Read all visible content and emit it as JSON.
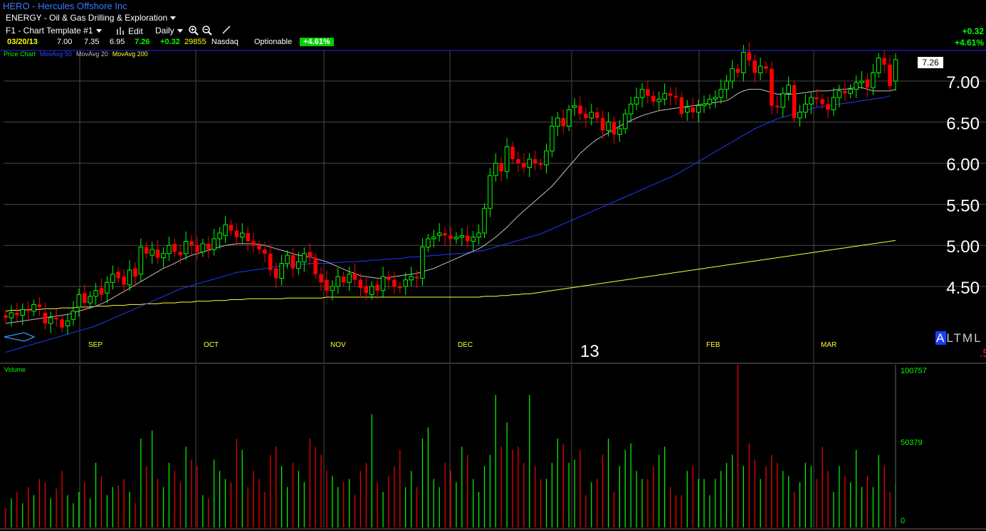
{
  "header": {
    "title": "HERO - Hercules Offshore Inc",
    "sector": "ENERGY - Oil & Gas Drilling & Exploration",
    "template": "F1 - Chart Template #1",
    "edit_label": "Edit",
    "period": "Daily",
    "quote": {
      "date": "03/20/13",
      "open": "7.00",
      "high": "7.35",
      "low": "6.95",
      "last": "7.26",
      "change": "+0.32",
      "volume": "29855",
      "exchange": "Nasdaq",
      "optionable": "Optionable",
      "pct_change": "+4.61%"
    },
    "right_change": "+0.32",
    "right_pct": "+4.61%"
  },
  "legend": {
    "price_chart": "Price Chart",
    "ma50": "MovAvg 50",
    "ma20": "MovAvg 20",
    "ma200": "MovAvg 200"
  },
  "last_price_badge": "7.26",
  "year_label": "13",
  "altml": {
    "a": "A",
    "rest": "LTML"
  },
  "red_mark": ".5",
  "colors": {
    "up": "#00ff00",
    "down": "#ff0000",
    "ma50": "#1f3cff",
    "ma20": "#c0c0c0",
    "ma200": "#ffff33",
    "grid": "#4a4a4a",
    "frame": "#2a2aff"
  },
  "chart_data": [
    {
      "type": "candlestick",
      "ylim": [
        4.0,
        7.5
      ],
      "y_ticks": [
        "7.00",
        "6.50",
        "6.00",
        "5.50",
        "5.00",
        "4.50"
      ],
      "x_tick_labels": [
        "SEP",
        "OCT",
        "NOV",
        "DEC",
        "FEB",
        "MAR"
      ],
      "grid": true,
      "close": [
        4.12,
        4.18,
        4.15,
        4.22,
        4.2,
        4.28,
        4.25,
        4.05,
        4.12,
        4.1,
        4.0,
        4.08,
        4.2,
        4.4,
        4.3,
        4.38,
        4.45,
        4.4,
        4.55,
        4.65,
        4.6,
        4.52,
        4.7,
        4.62,
        4.98,
        4.9,
        4.95,
        4.85,
        4.9,
        5.0,
        4.92,
        4.88,
        5.05,
        5.0,
        4.92,
        5.02,
        4.95,
        5.08,
        5.15,
        5.25,
        5.18,
        5.1,
        5.15,
        5.05,
        5.0,
        4.95,
        4.9,
        4.7,
        4.6,
        4.78,
        4.88,
        4.72,
        4.8,
        4.9,
        4.85,
        4.65,
        4.55,
        4.45,
        4.5,
        4.62,
        4.55,
        4.65,
        4.58,
        4.48,
        4.42,
        4.5,
        4.45,
        4.62,
        4.58,
        4.5,
        4.48,
        4.58,
        4.62,
        4.6,
        4.98,
        5.08,
        5.1,
        5.15,
        5.12,
        5.08,
        5.1,
        5.12,
        5.05,
        5.1,
        5.15,
        5.45,
        5.85,
        6.0,
        5.9,
        6.2,
        6.05,
        6.0,
        5.95,
        6.05,
        6.0,
        5.98,
        6.15,
        6.45,
        6.55,
        6.45,
        6.65,
        6.7,
        6.6,
        6.55,
        6.62,
        6.55,
        6.4,
        6.5,
        6.35,
        6.42,
        6.6,
        6.72,
        6.8,
        6.9,
        6.82,
        6.75,
        6.78,
        6.85,
        6.82,
        6.8,
        6.6,
        6.68,
        6.62,
        6.7,
        6.72,
        6.78,
        6.8,
        6.9,
        7.0,
        7.15,
        7.1,
        7.35,
        7.25,
        7.1,
        7.18,
        7.15,
        6.7,
        6.68,
        6.85,
        6.95,
        6.55,
        6.62,
        6.72,
        6.8,
        6.78,
        6.72,
        6.65,
        6.8,
        6.88,
        6.85,
        6.9,
        6.98,
        7.0,
        6.92,
        7.1,
        7.28,
        7.2,
        6.94,
        7.26
      ],
      "open": [
        4.15,
        4.12,
        4.18,
        4.15,
        4.22,
        4.2,
        4.28,
        4.18,
        4.05,
        4.12,
        4.1,
        4.02,
        4.1,
        4.25,
        4.42,
        4.3,
        4.38,
        4.48,
        4.42,
        4.55,
        4.68,
        4.62,
        4.52,
        4.72,
        4.65,
        4.98,
        4.88,
        4.95,
        4.85,
        4.9,
        5.02,
        4.92,
        4.9,
        5.05,
        5.0,
        4.92,
        5.02,
        4.95,
        5.08,
        5.12,
        5.25,
        5.18,
        5.1,
        5.15,
        5.05,
        5.0,
        4.95,
        4.9,
        4.72,
        4.6,
        4.78,
        4.88,
        4.72,
        4.8,
        4.92,
        4.85,
        4.65,
        4.58,
        4.45,
        4.5,
        4.62,
        4.55,
        4.66,
        4.58,
        4.5,
        4.4,
        4.52,
        4.45,
        4.62,
        4.58,
        4.5,
        4.5,
        4.58,
        4.62,
        4.6,
        4.98,
        5.08,
        5.12,
        5.15,
        5.12,
        5.08,
        5.1,
        5.12,
        5.05,
        5.1,
        5.15,
        5.45,
        5.85,
        6.0,
        5.9,
        6.2,
        6.05,
        6.0,
        5.95,
        6.05,
        6.0,
        5.98,
        6.15,
        6.45,
        6.55,
        6.45,
        6.68,
        6.7,
        6.6,
        6.55,
        6.62,
        6.55,
        6.4,
        6.5,
        6.35,
        6.42,
        6.6,
        6.72,
        6.8,
        6.9,
        6.82,
        6.75,
        6.78,
        6.85,
        6.82,
        6.8,
        6.62,
        6.68,
        6.62,
        6.7,
        6.72,
        6.78,
        6.8,
        6.9,
        7.0,
        7.15,
        7.1,
        7.35,
        7.25,
        7.1,
        7.18,
        7.15,
        6.7,
        6.68,
        6.85,
        6.95,
        6.55,
        6.62,
        6.72,
        6.8,
        6.78,
        6.72,
        6.65,
        6.8,
        6.88,
        6.85,
        6.9,
        6.98,
        7.02,
        6.92,
        7.1,
        7.28,
        7.2,
        7.0
      ],
      "ma20": [
        4.05,
        4.06,
        4.07,
        4.08,
        4.09,
        4.1,
        4.11,
        4.12,
        4.13,
        4.14,
        4.15,
        4.16,
        4.18,
        4.2,
        4.22,
        4.24,
        4.26,
        4.29,
        4.32,
        4.36,
        4.4,
        4.44,
        4.48,
        4.52,
        4.56,
        4.6,
        4.64,
        4.68,
        4.72,
        4.75,
        4.78,
        4.82,
        4.85,
        4.88,
        4.9,
        4.92,
        4.94,
        4.96,
        4.98,
        5.0,
        5.01,
        5.02,
        5.02,
        5.02,
        5.02,
        5.01,
        5.0,
        4.98,
        4.96,
        4.94,
        4.92,
        4.9,
        4.88,
        4.87,
        4.86,
        4.84,
        4.82,
        4.8,
        4.77,
        4.74,
        4.71,
        4.68,
        4.66,
        4.63,
        4.62,
        4.61,
        4.6,
        4.6,
        4.61,
        4.62,
        4.63,
        4.64,
        4.65,
        4.66,
        4.68,
        4.7,
        4.72,
        4.75,
        4.78,
        4.81,
        4.84,
        4.87,
        4.9,
        4.93,
        4.96,
        5.0,
        5.05,
        5.1,
        5.16,
        5.22,
        5.29,
        5.36,
        5.42,
        5.48,
        5.54,
        5.6,
        5.66,
        5.72,
        5.8,
        5.88,
        5.96,
        6.04,
        6.12,
        6.18,
        6.24,
        6.29,
        6.33,
        6.37,
        6.41,
        6.45,
        6.49,
        6.52,
        6.55,
        6.58,
        6.6,
        6.62,
        6.64,
        6.65,
        6.66,
        6.67,
        6.68,
        6.69,
        6.7,
        6.71,
        6.72,
        6.73,
        6.74,
        6.75,
        6.76,
        6.8,
        6.85,
        6.88,
        6.9,
        6.9,
        6.9,
        6.88,
        6.86,
        6.84,
        6.84,
        6.84,
        6.84,
        6.85,
        6.86,
        6.87,
        6.88,
        6.88,
        6.88,
        6.89,
        6.9,
        6.9,
        6.91,
        6.92,
        6.92,
        6.9,
        6.88,
        6.88,
        6.88,
        6.88,
        6.9
      ],
      "ma50": [
        3.7,
        3.72,
        3.74,
        3.76,
        3.78,
        3.8,
        3.82,
        3.84,
        3.86,
        3.88,
        3.9,
        3.92,
        3.94,
        3.96,
        3.98,
        4.0,
        4.02,
        4.05,
        4.08,
        4.11,
        4.14,
        4.17,
        4.2,
        4.23,
        4.26,
        4.29,
        4.32,
        4.35,
        4.38,
        4.41,
        4.44,
        4.47,
        4.49,
        4.51,
        4.53,
        4.55,
        4.57,
        4.59,
        4.61,
        4.63,
        4.65,
        4.67,
        4.68,
        4.69,
        4.7,
        4.71,
        4.72,
        4.73,
        4.74,
        4.75,
        4.76,
        4.76,
        4.77,
        4.77,
        4.78,
        4.78,
        4.78,
        4.78,
        4.79,
        4.79,
        4.8,
        4.8,
        4.8,
        4.81,
        4.81,
        4.82,
        4.82,
        4.83,
        4.83,
        4.84,
        4.84,
        4.85,
        4.86,
        4.86,
        4.87,
        4.87,
        4.88,
        4.88,
        4.89,
        4.89,
        4.9,
        4.9,
        4.91,
        4.92,
        4.93,
        4.94,
        4.96,
        4.98,
        5.0,
        5.02,
        5.04,
        5.06,
        5.08,
        5.1,
        5.12,
        5.14,
        5.17,
        5.2,
        5.23,
        5.26,
        5.29,
        5.32,
        5.35,
        5.38,
        5.41,
        5.44,
        5.47,
        5.5,
        5.53,
        5.56,
        5.59,
        5.62,
        5.65,
        5.68,
        5.71,
        5.74,
        5.77,
        5.8,
        5.83,
        5.86,
        5.9,
        5.94,
        5.98,
        6.02,
        6.06,
        6.1,
        6.14,
        6.18,
        6.22,
        6.26,
        6.3,
        6.34,
        6.38,
        6.42,
        6.45,
        6.48,
        6.51,
        6.54,
        6.56,
        6.58,
        6.6,
        6.62,
        6.64,
        6.66,
        6.68,
        6.69,
        6.7,
        6.71,
        6.72,
        6.73,
        6.74,
        6.75,
        6.76,
        6.77,
        6.78,
        6.79,
        6.8,
        6.82
      ],
      "ma200": [
        4.2,
        4.21,
        4.21,
        4.21,
        4.22,
        4.22,
        4.22,
        4.23,
        4.23,
        4.23,
        4.24,
        4.24,
        4.24,
        4.25,
        4.25,
        4.25,
        4.26,
        4.26,
        4.26,
        4.27,
        4.27,
        4.27,
        4.28,
        4.28,
        4.28,
        4.29,
        4.29,
        4.29,
        4.3,
        4.3,
        4.3,
        4.31,
        4.31,
        4.31,
        4.32,
        4.32,
        4.32,
        4.33,
        4.33,
        4.33,
        4.34,
        4.34,
        4.34,
        4.35,
        4.35,
        4.35,
        4.35,
        4.35,
        4.35,
        4.35,
        4.36,
        4.36,
        4.36,
        4.36,
        4.36,
        4.36,
        4.36,
        4.37,
        4.37,
        4.37,
        4.37,
        4.37,
        4.37,
        4.37,
        4.37,
        4.37,
        4.37,
        4.37,
        4.37,
        4.37,
        4.37,
        4.37,
        4.37,
        4.37,
        4.37,
        4.37,
        4.37,
        4.37,
        4.37,
        4.37,
        4.37,
        4.37,
        4.37,
        4.37,
        4.37,
        4.38,
        4.38,
        4.38,
        4.39,
        4.39,
        4.4,
        4.4,
        4.41,
        4.41,
        4.42,
        4.43,
        4.44,
        4.45,
        4.46,
        4.47,
        4.48,
        4.49,
        4.5,
        4.51,
        4.52,
        4.53,
        4.54,
        4.55,
        4.56,
        4.57,
        4.58,
        4.59,
        4.6,
        4.61,
        4.62,
        4.63,
        4.64,
        4.65,
        4.66,
        4.67,
        4.68,
        4.69,
        4.7,
        4.71,
        4.72,
        4.73,
        4.74,
        4.75,
        4.76,
        4.77,
        4.78,
        4.79,
        4.8,
        4.81,
        4.82,
        4.83,
        4.84,
        4.85,
        4.86,
        4.87,
        4.88,
        4.89,
        4.9,
        4.91,
        4.92,
        4.93,
        4.94,
        4.95,
        4.96,
        4.97,
        4.98,
        4.99,
        5.0,
        5.01,
        5.02,
        5.03,
        5.04,
        5.05,
        5.06
      ]
    },
    {
      "type": "bar",
      "title": "Volume",
      "y_ticks": [
        "100757",
        "50379",
        "0"
      ],
      "ylim": [
        0,
        100757
      ],
      "values": [
        12000,
        18000,
        22000,
        15000,
        25000,
        20000,
        30000,
        28000,
        18000,
        24000,
        35000,
        20000,
        15000,
        22000,
        28000,
        18000,
        40000,
        32000,
        20000,
        25000,
        26000,
        30000,
        22000,
        15000,
        55000,
        38000,
        60000,
        30000,
        25000,
        40000,
        35000,
        28000,
        50000,
        42000,
        38000,
        20000,
        18000,
        42000,
        35000,
        30000,
        28000,
        55000,
        48000,
        25000,
        35000,
        30000,
        22000,
        45000,
        50000,
        38000,
        25000,
        40000,
        35000,
        28000,
        55000,
        50000,
        45000,
        35000,
        32000,
        25000,
        28000,
        30000,
        20000,
        35000,
        40000,
        70000,
        28000,
        22000,
        32000,
        38000,
        48000,
        25000,
        35000,
        25000,
        55000,
        62000,
        30000,
        25000,
        40000,
        35000,
        28000,
        50000,
        45000,
        30000,
        22000,
        38000,
        45000,
        82000,
        50000,
        65000,
        48000,
        50000,
        40000,
        82000,
        38000,
        30000,
        30000,
        40000,
        55000,
        52000,
        40000,
        42000,
        48000,
        20000,
        28000,
        30000,
        45000,
        55000,
        22000,
        38000,
        48000,
        52000,
        35000,
        30000,
        30000,
        38000,
        45000,
        50000,
        25000,
        20000,
        20000,
        35000,
        38000,
        30000,
        30000,
        20000,
        30000,
        35000,
        40000,
        45000,
        100757,
        38000,
        52000,
        42000,
        30000,
        38000,
        45000,
        40000,
        35000,
        32000,
        22000,
        28000,
        40000,
        38000,
        30000,
        50000,
        35000,
        22000,
        38000,
        32000,
        28000,
        48000,
        25000,
        32000,
        25000,
        45000,
        38000,
        22000,
        28000,
        20000,
        30000
      ],
      "colors_from_candle": true
    }
  ]
}
